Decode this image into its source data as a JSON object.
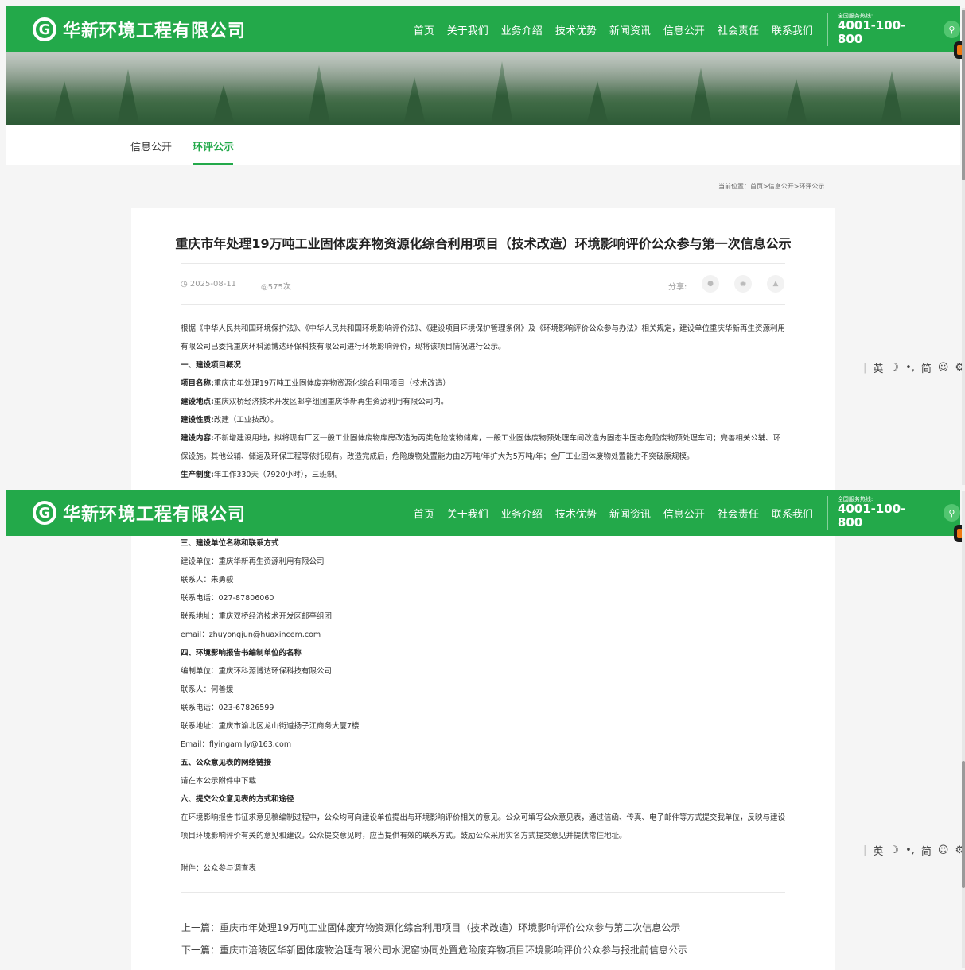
{
  "header": {
    "logo_mark": "G",
    "company": "华新环境工程有限公司",
    "nav": [
      "首页",
      "关于我们",
      "业务介绍",
      "技术优势",
      "新闻资讯",
      "信息公开",
      "社会责任",
      "联系我们"
    ],
    "hotline_label": "全国服务热线:",
    "hotline_number": "4001-100-800"
  },
  "subnav": {
    "tabs": [
      "信息公开",
      "环评公示"
    ],
    "active": "环评公示"
  },
  "breadcrumb": "当前位置：首页>信息公开>环评公示",
  "article": {
    "title": "重庆市年处理19万吨工业固体废弃物资源化综合利用项目（技术改造）环境影响评价公众参与第一次信息公示",
    "date": "2025-08-11",
    "views": "575次",
    "share_label": "分享:",
    "intro": "根据《中华人民共和国环境保护法》、《中华人民共和国环境影响评价法》、《建设项目环境保护管理条例》及《环境影响评价公众参与办法》相关规定，建设单位重庆华新再生资源利用有限公司已委托重庆环科源博达环保科技有限公司进行环境影响评价，现将该项目情况进行公示。",
    "sec1_heading": "一、建设项目概况",
    "project_name_label": "项目名称:",
    "project_name": "重庆市年处理19万吨工业固体废弃物资源化综合利用项目（技术改造）",
    "location_label": "建设地点:",
    "location": "重庆双桥经济技术开发区邮亭组团重庆华新再生资源利用有限公司内。",
    "nature_label": "建设性质:",
    "nature": "改建（工业技改）。",
    "content_label": "建设内容:",
    "content": "不新增建设用地，拟将现有厂区一般工业固体废物库房改造为丙类危险废物储库，一般工业固体废物预处理车间改造为固态半固态危险废物预处理车间；完善相关公辅、环保设施。其他公辅、储运及环保工程等依托现有。改造完成后，危险废物处置能力由2万吨/年扩大为5万吨/年；全厂工业固体废物处置能力不突破原规模。",
    "schedule_label": "生产制度:",
    "schedule": "年工作330天（7920小时），三班制。",
    "sec3_heading": "三、建设单位名称和联系方式",
    "unit": "建设单位：重庆华新再生资源利用有限公司",
    "contact": "联系人：朱勇骏",
    "phone": "联系电话：027-87806060",
    "address": "联系地址：重庆双桥经济技术开发区邮亭组团",
    "email": "email：zhuyongjun@huaxincem.com",
    "sec4_heading": "四、环境影响报告书编制单位的名称",
    "unit2": "编制单位：重庆环科源博达环保科技有限公司",
    "contact2": "联系人：何善媛",
    "phone2": "联系电话：023-67826599",
    "address2": "联系地址：重庆市渝北区龙山街道扬子江商务大厦7楼",
    "email2": "Email：flyingamily@163.com",
    "sec5_heading": "五、公众意见表的网络链接",
    "sec5_text": "请在本公示附件中下载",
    "sec6_heading": "六、提交公众意见表的方式和途径",
    "sec6_text": "在环境影响报告书征求意见稿编制过程中，公众均可向建设单位提出与环境影响评价相关的意见。公众可填写公众意见表，通过信函、传真、电子邮件等方式提交我单位，反映与建设项目环境影响评价有关的意见和建议。公众提交意见时，应当提供有效的联系方式。鼓励公众采用实名方式提交意见并提供常住地址。",
    "attachment": "附件：公众参与调查表",
    "prev": "上一篇：重庆市年处理19万吨工业固体废弃物资源化综合利用项目（技术改造）环境影响评价公众参与第二次信息公示",
    "next": "下一篇：重庆市涪陵区华新固体废物治理有限公司水泥窑协同处置危险废弃物项目环境影响评价公众参与报批前信息公示"
  },
  "toolbar": {
    "items": [
      "英",
      "☽",
      "•,",
      "简",
      "☺",
      "⚙"
    ]
  }
}
